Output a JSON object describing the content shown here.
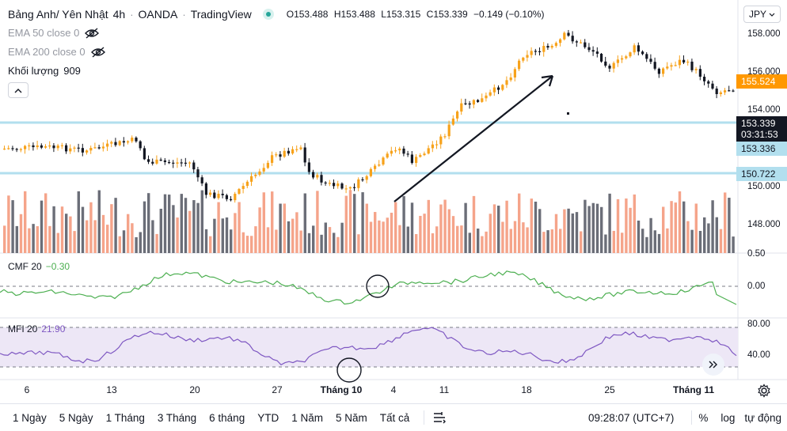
{
  "header": {
    "symbol": "Bảng Anh/ Yên Nhật",
    "interval": "4h",
    "exchange": "OANDA",
    "source": "TradingView",
    "open_label": "O",
    "open": "153.488",
    "high_label": "H",
    "high": "153.488",
    "low_label": "L",
    "low": "153.315",
    "close_label": "C",
    "close": "153.339",
    "change": "−0.149 (−0.10%)",
    "currency": "JPY",
    "status_color": "#26a69a"
  },
  "legend": {
    "ema50": "EMA 50 close 0",
    "ema200": "EMA 200 close 0",
    "volume_label": "Khối lượng",
    "volume_value": "909"
  },
  "price_axis": [
    "158.000",
    "156.000",
    "154.000",
    "150.000",
    "148.000"
  ],
  "price_tags": {
    "orange": "155.524",
    "current": "153.339",
    "countdown": "03:31:53",
    "line_a": "153.336",
    "line_b": "150.722"
  },
  "cmf": {
    "title": "CMF 20",
    "value": "−0.30",
    "axis": [
      "0.50",
      "0.00"
    ]
  },
  "mfi": {
    "title": "MFI 20",
    "value": "21.90",
    "axis": [
      "80.00",
      "40.00"
    ]
  },
  "time_axis": [
    "6",
    "13",
    "20",
    "27",
    "Tháng 10",
    "4",
    "11",
    "18",
    "25",
    "Tháng 11"
  ],
  "bottom_bar": {
    "ranges": [
      "1 Ngày",
      "5 Ngày",
      "1 Tháng",
      "3 Tháng",
      "6 tháng",
      "YTD",
      "1 Năm",
      "5 Năm",
      "Tất cả"
    ],
    "clock": "09:28:07 (UTC+7)",
    "percent": "%",
    "log": "log",
    "auto": "tự động"
  },
  "icons": [
    "eye-off-icon",
    "chevron-up-icon",
    "chevron-down-icon",
    "settings-gear-icon",
    "date-range-icon",
    "double-chevron-right-icon"
  ],
  "colors": {
    "up": "#f7a21b",
    "down": "#131722",
    "vol_up": "#f5a48a",
    "vol_down": "#6b6e78",
    "cmf": "#4caf50",
    "mfi": "#7e57c2",
    "band": "#ede7f6",
    "hline": "#b2dfee",
    "price_tag": "#ff9800",
    "current_tag": "#131722",
    "line_tag": "#b2dfee"
  }
}
